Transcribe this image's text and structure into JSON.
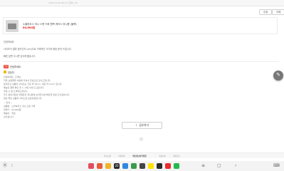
{
  "header": {
    "meta": "2020.12.09 06:22 조회수 35"
  },
  "actions": {
    "edit_label": "수정",
    "delete_label": "삭제"
  },
  "product": {
    "name": "노블하우스 미니 스탠 가위 원목 케이스 미니용 (블랙)",
    "price": "64,800원"
  },
  "post": {
    "lines": [
      "안녕하세요",
      "사이즈가 얼마 정도인지 (cm)으로 구체적인 크기와 배송 문의 드립니다.",
      "빠른 답변 주시면 감사하겠습니다."
    ]
  },
  "reply": {
    "tag": "답변",
    "title": "안녕하세요",
    "badge_label": "담당자",
    "lines": [
      "안녕하세요, 고객님.",
      "저희 쇼핑몰을 이용해 주셔서 진심으로 감사드립니다.",
      "문의주신 상품의 사이즈는 가로 약 18cm, 세로 약 12cm 입니다.",
      "배송은 결제 확인 후 1~3일 이내 출고됩니다.",
      "주문 시 참고 부탁드립니다.",
      "추가 문의사항은 언제든지 게시판에 남겨주시면 빠르게 답변 드리겠습니다.",
      "항상 좋은 상품과 서비스로 보답하겠습니다.",
      "~ 안내 ~",
      "상품명 : 노블하우스 미니 스탠 가위",
      "판매가 : 64,800원",
      "배송비 : 무료",
      "감사합니다."
    ]
  },
  "share": {
    "label": "공유하기"
  },
  "pagination": {
    "indicator": "1"
  },
  "footer": {
    "links": [
      "회사소개",
      "이용약관",
      "개인정보처리방침",
      "이용안내",
      "제휴문의"
    ]
  },
  "taskbar": {
    "apps": [
      {
        "name": "gallery-app",
        "color": "#e24d5e"
      },
      {
        "name": "calendar-app",
        "color": "#e65b3c"
      },
      {
        "name": "messages-app",
        "color": "#f0b429"
      },
      {
        "name": "date-app",
        "color": "#2a2a2a",
        "label": "20"
      },
      {
        "name": "phone-app",
        "color": "#2f88e0"
      },
      {
        "name": "chrome-app",
        "color": "#3a9c4a"
      },
      {
        "name": "camera-app",
        "color": "#444444"
      },
      {
        "name": "kakao-app",
        "color": "#ffe300"
      },
      {
        "name": "play-store-app",
        "color": "#2a2a2a"
      },
      {
        "name": "youtube-app",
        "color": "#ec2b2b"
      },
      {
        "name": "naver-app",
        "color": "#23b94d"
      }
    ],
    "accent": "#e94b3c"
  }
}
